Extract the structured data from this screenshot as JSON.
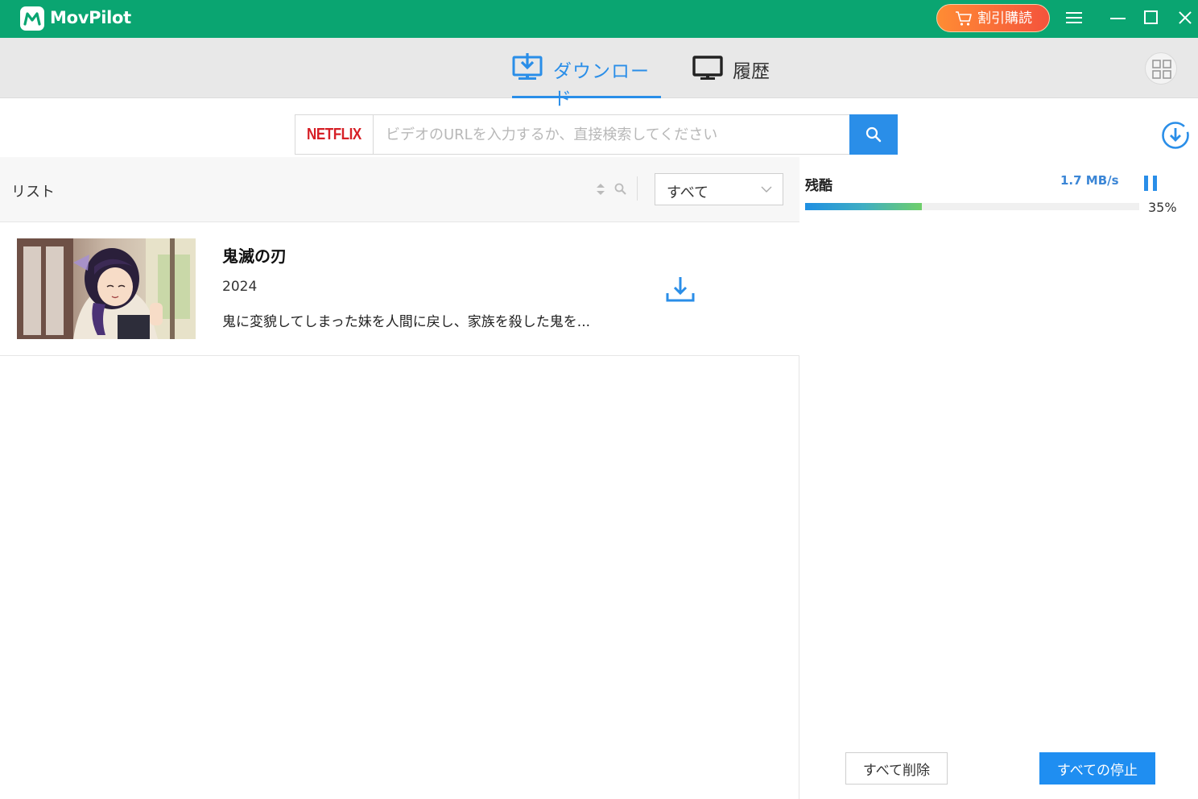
{
  "app": {
    "title": "MovPilot",
    "brand_color": "#0aa571",
    "subscribe_label": "割引購読"
  },
  "tabs": [
    {
      "label": "ダウンロード",
      "icon": "download-monitor-icon",
      "active": true
    },
    {
      "label": "履歴",
      "icon": "monitor-icon",
      "active": false
    }
  ],
  "search": {
    "service": "NETFLIX",
    "placeholder": "ビデオのURLを入力するか、直接検索してください",
    "value": ""
  },
  "list": {
    "title": "リスト",
    "filter_value": "すべて",
    "items": [
      {
        "title": "鬼滅の刃",
        "year": "2024",
        "description": "鬼に変貌してしまった妹を人間に戻し、家族を殺した鬼を..."
      }
    ]
  },
  "downloads": {
    "items": [
      {
        "title": "残酷",
        "speed": "1.7 MB/s",
        "progress": 35,
        "progress_label": "35%"
      }
    ],
    "delete_all_label": "すべて削除",
    "stop_all_label": "すべての停止"
  }
}
